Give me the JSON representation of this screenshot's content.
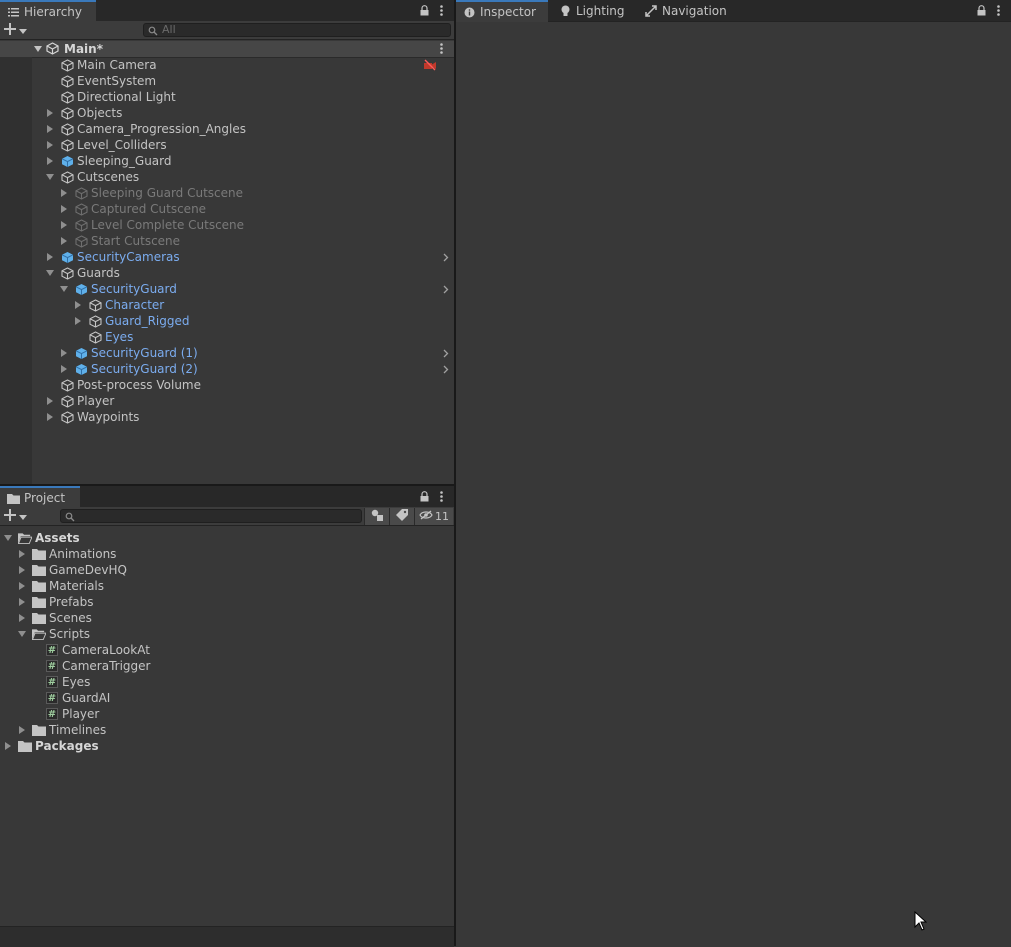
{
  "hierarchy": {
    "tab_label": "Hierarchy",
    "search_placeholder": "All",
    "scene_name": "Main*",
    "items": [
      {
        "label": "Main Camera",
        "depth": 0,
        "arrow": "none",
        "icon": "cube",
        "style": "normal",
        "badge": true
      },
      {
        "label": "EventSystem",
        "depth": 0,
        "arrow": "none",
        "icon": "cube",
        "style": "normal"
      },
      {
        "label": "Directional Light",
        "depth": 0,
        "arrow": "none",
        "icon": "cube",
        "style": "normal"
      },
      {
        "label": "Objects",
        "depth": 0,
        "arrow": "right",
        "icon": "cube",
        "style": "normal"
      },
      {
        "label": "Camera_Progression_Angles",
        "depth": 0,
        "arrow": "right",
        "icon": "cube",
        "style": "normal"
      },
      {
        "label": "Level_Colliders",
        "depth": 0,
        "arrow": "right",
        "icon": "cube",
        "style": "normal"
      },
      {
        "label": "Sleeping_Guard",
        "depth": 0,
        "arrow": "right",
        "icon": "prefab",
        "style": "normal"
      },
      {
        "label": "Cutscenes",
        "depth": 0,
        "arrow": "down",
        "icon": "cube",
        "style": "normal"
      },
      {
        "label": "Sleeping Guard Cutscene",
        "depth": 1,
        "arrow": "right",
        "icon": "cube",
        "style": "dim"
      },
      {
        "label": "Captured Cutscene",
        "depth": 1,
        "arrow": "right",
        "icon": "cube",
        "style": "dim"
      },
      {
        "label": "Level Complete Cutscene",
        "depth": 1,
        "arrow": "right",
        "icon": "cube",
        "style": "dim"
      },
      {
        "label": "Start Cutscene",
        "depth": 1,
        "arrow": "right",
        "icon": "cube",
        "style": "dim"
      },
      {
        "label": "SecurityCameras",
        "depth": 0,
        "arrow": "right",
        "icon": "prefab",
        "style": "blue",
        "chevron": true
      },
      {
        "label": "Guards",
        "depth": 0,
        "arrow": "down",
        "icon": "cube",
        "style": "normal"
      },
      {
        "label": "SecurityGuard",
        "depth": 1,
        "arrow": "down",
        "icon": "prefab",
        "style": "blue",
        "chevron": true
      },
      {
        "label": "Character",
        "depth": 2,
        "arrow": "right",
        "icon": "cube",
        "style": "blue"
      },
      {
        "label": "Guard_Rigged",
        "depth": 2,
        "arrow": "right",
        "icon": "cube",
        "style": "blue"
      },
      {
        "label": "Eyes",
        "depth": 2,
        "arrow": "none",
        "icon": "cube",
        "style": "blue"
      },
      {
        "label": "SecurityGuard (1)",
        "depth": 1,
        "arrow": "right",
        "icon": "prefab",
        "style": "blue",
        "chevron": true
      },
      {
        "label": "SecurityGuard (2)",
        "depth": 1,
        "arrow": "right",
        "icon": "prefab",
        "style": "blue",
        "chevron": true
      },
      {
        "label": "Post-process Volume",
        "depth": 0,
        "arrow": "none",
        "icon": "cube",
        "style": "normal"
      },
      {
        "label": "Player",
        "depth": 0,
        "arrow": "right",
        "icon": "cube",
        "style": "normal"
      },
      {
        "label": "Waypoints",
        "depth": 0,
        "arrow": "right",
        "icon": "cube",
        "style": "normal"
      }
    ]
  },
  "project": {
    "tab_label": "Project",
    "hidden_count": "11",
    "items": [
      {
        "label": "Assets",
        "depth": 0,
        "arrow": "down",
        "icon": "folder-open",
        "style": "bold"
      },
      {
        "label": "Animations",
        "depth": 1,
        "arrow": "right",
        "icon": "folder",
        "style": "normal"
      },
      {
        "label": "GameDevHQ",
        "depth": 1,
        "arrow": "right",
        "icon": "folder",
        "style": "normal"
      },
      {
        "label": "Materials",
        "depth": 1,
        "arrow": "right",
        "icon": "folder",
        "style": "normal"
      },
      {
        "label": "Prefabs",
        "depth": 1,
        "arrow": "right",
        "icon": "folder",
        "style": "normal"
      },
      {
        "label": "Scenes",
        "depth": 1,
        "arrow": "right",
        "icon": "folder",
        "style": "normal"
      },
      {
        "label": "Scripts",
        "depth": 1,
        "arrow": "down",
        "icon": "folder-open",
        "style": "normal"
      },
      {
        "label": "CameraLookAt",
        "depth": 2,
        "arrow": "none",
        "icon": "script",
        "style": "normal"
      },
      {
        "label": "CameraTrigger",
        "depth": 2,
        "arrow": "none",
        "icon": "script",
        "style": "normal"
      },
      {
        "label": "Eyes",
        "depth": 2,
        "arrow": "none",
        "icon": "script",
        "style": "normal"
      },
      {
        "label": "GuardAI",
        "depth": 2,
        "arrow": "none",
        "icon": "script",
        "style": "normal"
      },
      {
        "label": "Player",
        "depth": 2,
        "arrow": "none",
        "icon": "script",
        "style": "normal"
      },
      {
        "label": "Timelines",
        "depth": 1,
        "arrow": "right",
        "icon": "folder",
        "style": "normal"
      },
      {
        "label": "Packages",
        "depth": 0,
        "arrow": "right",
        "icon": "folder",
        "style": "bold"
      }
    ]
  },
  "inspector": {
    "tabs": [
      {
        "label": "Inspector",
        "icon": "info-icon"
      },
      {
        "label": "Lighting",
        "icon": "lightbulb-icon"
      },
      {
        "label": "Navigation",
        "icon": "navigation-icon"
      }
    ]
  },
  "colors": {
    "accent": "#3a79bb",
    "prefab_text": "#7bacef",
    "prefab_icon": "#5fb0ea",
    "disabled_text": "#7a7a7a"
  }
}
